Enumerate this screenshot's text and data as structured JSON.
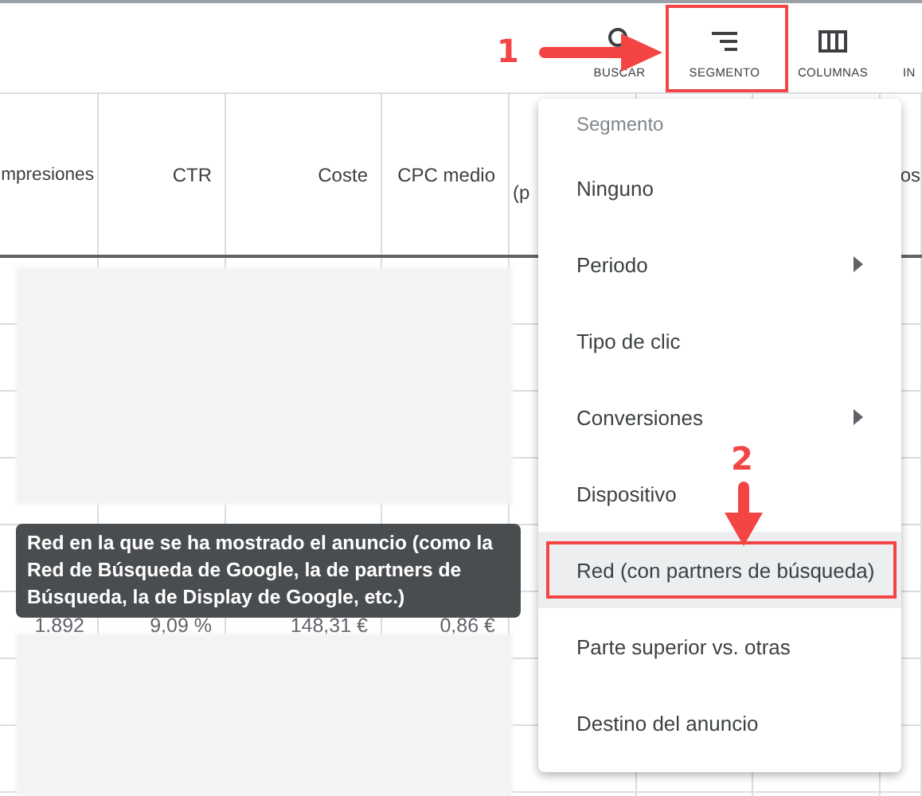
{
  "toolbar": {
    "buttons": [
      {
        "label": "BUSCAR",
        "kind": "search"
      },
      {
        "label": "SEGMENTO",
        "kind": "segment"
      },
      {
        "label": "COLUMNAS",
        "kind": "columns"
      },
      {
        "label": "IN",
        "kind": "cut"
      }
    ]
  },
  "table": {
    "columns": [
      {
        "label": "mpresiones"
      },
      {
        "label": "CTR"
      },
      {
        "label": "Coste"
      },
      {
        "label": "CPC medio"
      },
      {
        "label": "(p"
      },
      {
        "label": "os"
      }
    ],
    "rows": [
      {
        "cells": [
          "1.892",
          "9,09 %",
          "148,31 €",
          "0,86 €"
        ]
      }
    ]
  },
  "tooltip": {
    "text": "Red en la que se ha mostrado el anuncio (como la Red de Búsqueda de Google, la de partners de Búsqueda, la de Display de Google, etc.)"
  },
  "menu": {
    "title": "Segmento",
    "items": [
      {
        "label": "Ninguno",
        "submenu": false,
        "selected": false
      },
      {
        "label": "Periodo",
        "submenu": true,
        "selected": false
      },
      {
        "label": "Tipo de clic",
        "submenu": false,
        "selected": false
      },
      {
        "label": "Conversiones",
        "submenu": true,
        "selected": false
      },
      {
        "label": "Dispositivo",
        "submenu": false,
        "selected": false
      },
      {
        "label": "Red (con partners de búsqueda)",
        "submenu": false,
        "selected": true
      },
      {
        "label": "Parte superior vs. otras",
        "submenu": false,
        "selected": false
      },
      {
        "label": "Destino del anuncio",
        "submenu": false,
        "selected": false
      }
    ]
  },
  "annotations": [
    {
      "kind": "arrow-right",
      "number": "1"
    },
    {
      "kind": "arrow-down",
      "number": "2"
    }
  ]
}
